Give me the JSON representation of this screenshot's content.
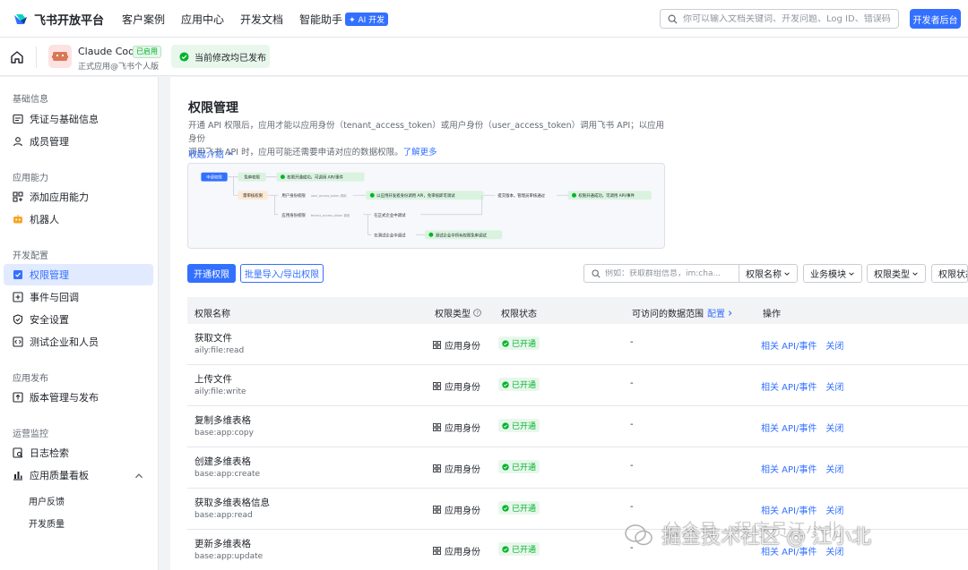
{
  "header": {
    "brand": "飞书开放平台",
    "nav": [
      "客户案例",
      "应用中心",
      "开发文档",
      "智能助手"
    ],
    "ai_badge": "AI 开发",
    "search_placeholder": "你可以输入文档关键词、开发问题、Log ID、错误码",
    "dev_console": "开发者后台"
  },
  "app": {
    "name": "Claude Code",
    "tag": "已启用",
    "subtitle": "正式应用@飞书个人版",
    "status": "当前修改均已发布"
  },
  "sidebar": {
    "sections": [
      {
        "title": "基础信息",
        "items": [
          "凭证与基础信息",
          "成员管理"
        ]
      },
      {
        "title": "应用能力",
        "items": [
          "添加应用能力",
          "机器人"
        ]
      },
      {
        "title": "开发配置",
        "items": [
          "权限管理",
          "事件与回调",
          "安全设置",
          "测试企业和人员"
        ]
      },
      {
        "title": "应用发布",
        "items": [
          "版本管理与发布"
        ]
      },
      {
        "title": "运营监控",
        "items": [
          "日志检索",
          "应用质量看板"
        ]
      }
    ],
    "sub_items": [
      "用户反馈",
      "开发质量"
    ],
    "active": "权限管理"
  },
  "main": {
    "title": "权限管理",
    "desc_line1": "开通 API 权限后，应用才能以应用身份（tenant_access_token）或用户身份（user_access_token）调用飞书 API；以应用身份",
    "desc_line2": "调用飞书 API 时，应用可能还需要申请对应的数据权限。",
    "learn_more": "了解更多",
    "collapse": "收起介绍",
    "flow": {
      "apply": "申请权限",
      "free": "免审权限",
      "free_result": "权限开通成功，可调用 API/事件",
      "review": "需审核权限",
      "user_identity": "用户身份权限",
      "user_token": "user_access_token 调用",
      "user_dev": "以应用开发者身份调用 API，免审核即可调试",
      "submit": "提交版本，管理员审核通过",
      "review_result": "权限开通成功，可调用 API/事件",
      "app_identity": "应用身份权限",
      "app_token": "tenant_access_token 调用",
      "formal_debug": "在正式企业中调试",
      "test_debug": "在测试企业中调试",
      "test_result": "测试企业中所有权限免审调试"
    },
    "btn_open": "开通权限",
    "btn_batch": "批量导入/导出权限",
    "filter_placeholder": "例如：获取群组信息，im:cha...",
    "filters": [
      "权限名称",
      "业务模块",
      "权限类型",
      "权限状态"
    ],
    "columns": {
      "name": "权限名称",
      "type": "权限类型",
      "status": "权限状态",
      "scope": "可访问的数据范围",
      "scope_link": "配置",
      "ops": "操作"
    },
    "rows": [
      {
        "name": "获取文件",
        "code": "aily:file:read",
        "type": "应用身份",
        "status": "已开通",
        "scope": "-",
        "act1": "相关 API/事件",
        "act2": "关闭"
      },
      {
        "name": "上传文件",
        "code": "aily:file:write",
        "type": "应用身份",
        "status": "已开通",
        "scope": "-",
        "act1": "相关 API/事件",
        "act2": "关闭"
      },
      {
        "name": "复制多维表格",
        "code": "base:app:copy",
        "type": "应用身份",
        "status": "已开通",
        "scope": "-",
        "act1": "相关 API/事件",
        "act2": "关闭"
      },
      {
        "name": "创建多维表格",
        "code": "base:app:create",
        "type": "应用身份",
        "status": "已开通",
        "scope": "-",
        "act1": "相关 API/事件",
        "act2": "关闭"
      },
      {
        "name": "获取多维表格信息",
        "code": "base:app:read",
        "type": "应用身份",
        "status": "已开通",
        "scope": "-",
        "act1": "相关 API/事件",
        "act2": "关闭"
      },
      {
        "name": "更新多维表格",
        "code": "base:app:update",
        "type": "应用身份",
        "status": "已开通",
        "scope": "-",
        "act1": "相关 API/事件",
        "act2": "关闭"
      }
    ]
  },
  "watermark": {
    "line1": "公众号 · 程序员江小北",
    "line2": "掘金技术社区 @ 江小北"
  },
  "colors": {
    "accent": "#3370ff",
    "success": "#00b42a",
    "success_bg": "#e8f7ec"
  }
}
